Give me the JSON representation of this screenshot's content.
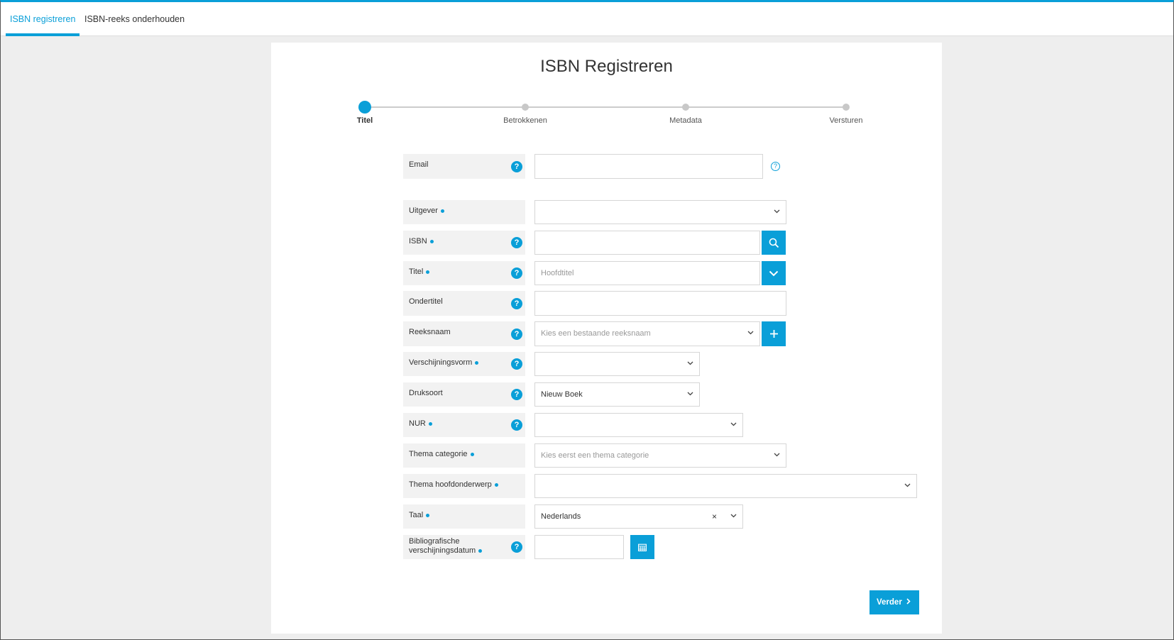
{
  "tabs": [
    {
      "label": "ISBN registreren",
      "active": true
    },
    {
      "label": "ISBN-reeks onderhouden",
      "active": false
    }
  ],
  "page": {
    "title": "ISBN Registreren"
  },
  "steps": [
    {
      "label": "Titel",
      "active": true
    },
    {
      "label": "Betrokkenen",
      "active": false
    },
    {
      "label": "Metadata",
      "active": false
    },
    {
      "label": "Versturen",
      "active": false
    }
  ],
  "form": {
    "email": {
      "label": "Email",
      "value": ""
    },
    "uitgever": {
      "label": "Uitgever",
      "value": ""
    },
    "isbn": {
      "label": "ISBN",
      "value": ""
    },
    "titel": {
      "label": "Titel",
      "placeholder": "Hoofdtitel"
    },
    "ondertitel": {
      "label": "Ondertitel",
      "value": ""
    },
    "reeksnaam": {
      "label": "Reeksnaam",
      "placeholder": "Kies een bestaande reeksnaam"
    },
    "verschijningsvorm": {
      "label": "Verschijningsvorm",
      "value": ""
    },
    "druksoort": {
      "label": "Druksoort",
      "value": "Nieuw Boek"
    },
    "nur": {
      "label": "NUR",
      "value": ""
    },
    "thema_categorie": {
      "label": "Thema categorie",
      "placeholder": "Kies eerst een thema categorie"
    },
    "thema_hoofdonderwerp": {
      "label": "Thema hoofdonderwerp",
      "value": ""
    },
    "taal": {
      "label": "Taal",
      "value": "Nederlands",
      "clear": "×"
    },
    "datum": {
      "label_line1": "Bibliografische",
      "label_line2": "verschijningsdatum",
      "value": ""
    }
  },
  "help_glyph": "?",
  "buttons": {
    "next": "Verder"
  },
  "colors": {
    "accent": "#0a9fd8",
    "label_bg": "#f2f2f2",
    "background": "#eeeeee"
  },
  "icons": [
    "search-icon",
    "chevron-down-icon",
    "plus-icon",
    "calendar-icon",
    "chevron-right-icon",
    "help-icon"
  ]
}
